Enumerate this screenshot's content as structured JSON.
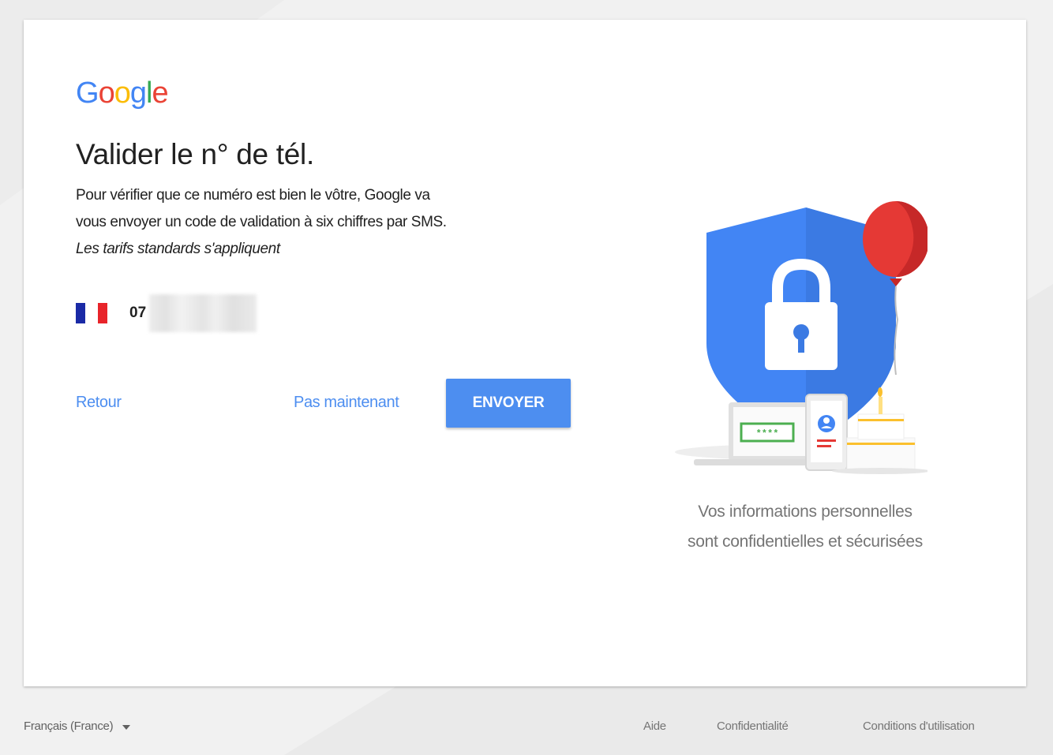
{
  "brand": {
    "logo_letters": [
      {
        "ch": "G",
        "color": "#4285F4"
      },
      {
        "ch": "o",
        "color": "#EA4335"
      },
      {
        "ch": "o",
        "color": "#FBBC05"
      },
      {
        "ch": "g",
        "color": "#4285F4"
      },
      {
        "ch": "l",
        "color": "#34A853"
      },
      {
        "ch": "e",
        "color": "#EA4335"
      }
    ]
  },
  "main": {
    "title": "Valider le n° de tél.",
    "description_line1": "Pour vérifier que ce numéro est bien le vôtre, Google va",
    "description_line2": "vous envoyer un code de validation à six chiffres par SMS.",
    "description_note": "Les tarifs standards s'appliquent",
    "phone": {
      "country_flag": "france-flag",
      "prefix": "07",
      "redacted": true
    }
  },
  "actions": {
    "back_label": "Retour",
    "later_label": "Pas maintenant",
    "send_label": "ENVOYER"
  },
  "illustration": {
    "icons": [
      "shield-lock-icon",
      "balloon-icon",
      "laptop-icon",
      "phone-icon",
      "cake-icon"
    ],
    "password_mask": "****",
    "caption_line1": "Vos informations personnelles",
    "caption_line2": "sont confidentielles et sécurisées"
  },
  "footer": {
    "language": "Français (France)",
    "help": "Aide",
    "privacy": "Confidentialité",
    "terms": "Conditions d'utilisation"
  },
  "colors": {
    "accent": "#4d8ef0",
    "shield": "#4285F4",
    "balloon": "#E53935",
    "background": "#f1f1f1"
  }
}
